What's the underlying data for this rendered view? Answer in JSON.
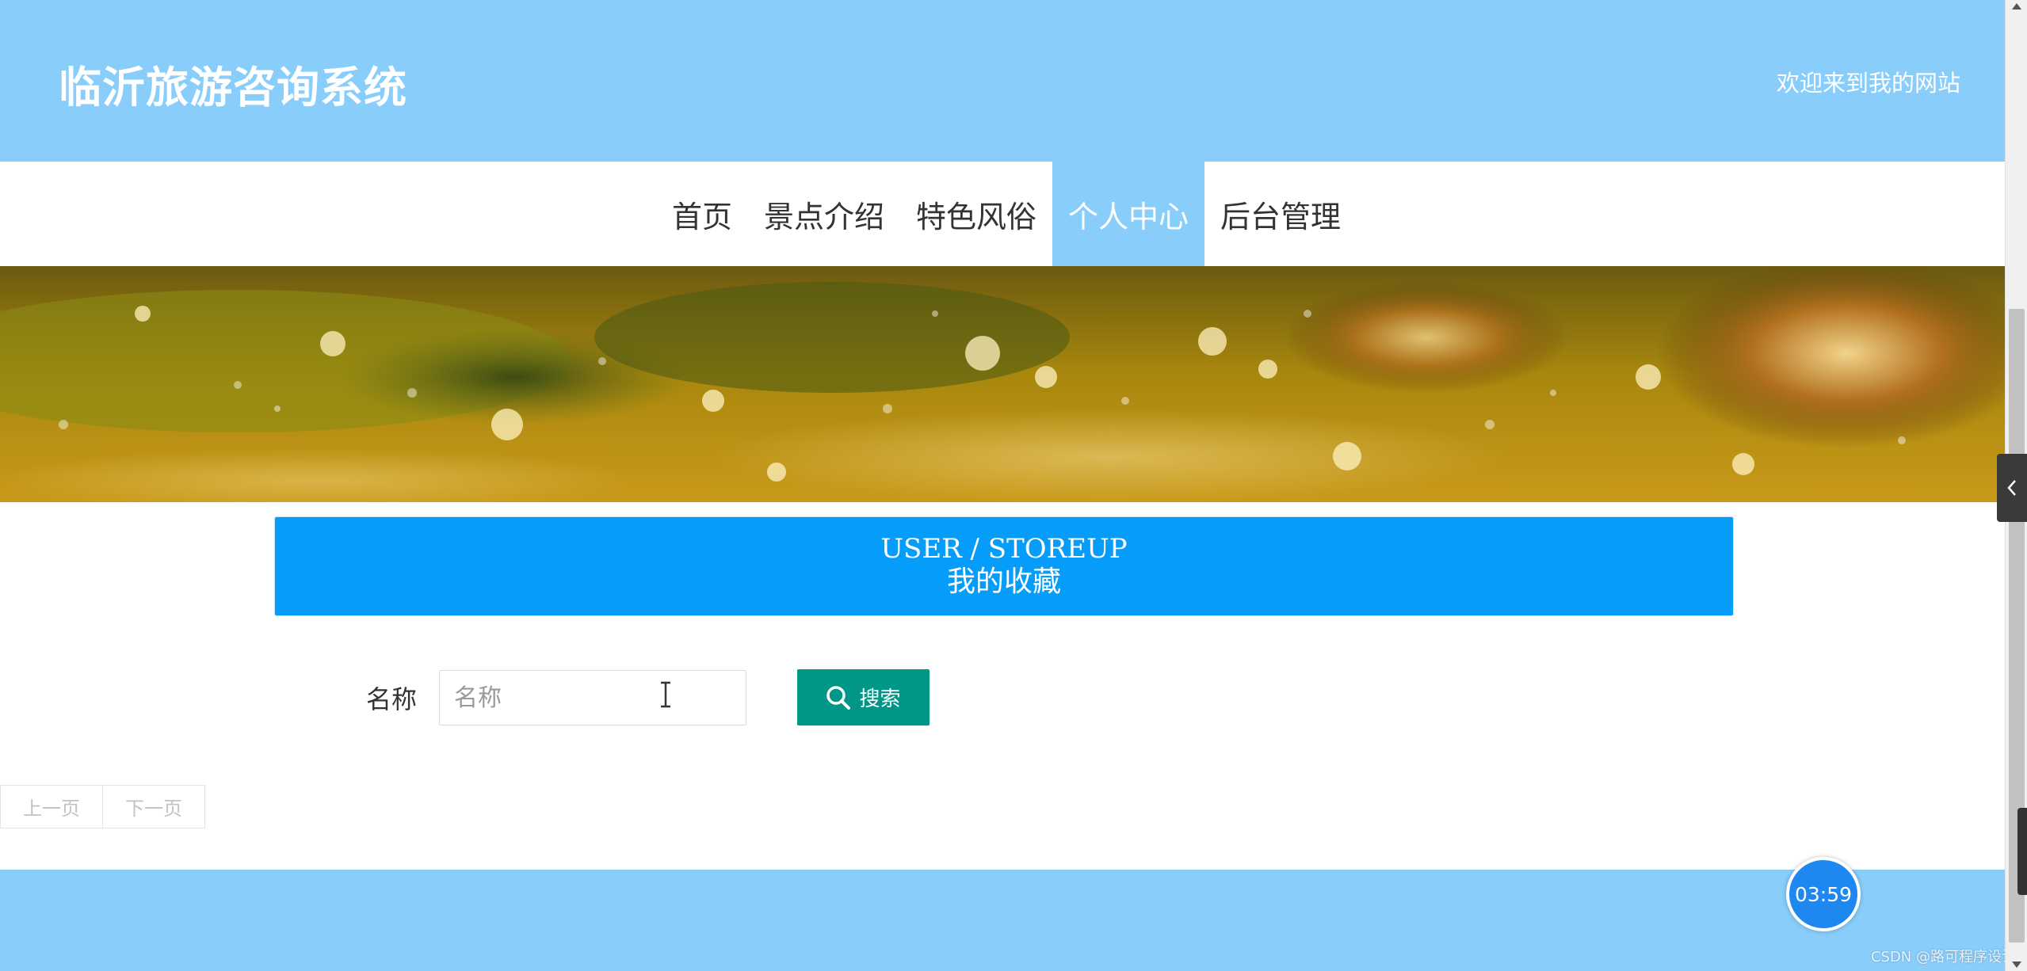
{
  "header": {
    "site_title": "临沂旅游咨询系统",
    "welcome_text": "欢迎来到我的网站"
  },
  "nav": {
    "items": [
      {
        "label": "首页"
      },
      {
        "label": "景点介绍"
      },
      {
        "label": "特色风俗"
      },
      {
        "label": "个人中心",
        "active": true
      },
      {
        "label": "后台管理"
      }
    ]
  },
  "banner": {
    "slide_count": 3,
    "active_slide": 1
  },
  "section": {
    "title_en": "USER / STOREUP",
    "title_cn": "我的收藏"
  },
  "search": {
    "label": "名称",
    "placeholder": "名称",
    "value": "",
    "button_label": "搜索",
    "button_icon": "search-icon"
  },
  "pagination": {
    "prev_label": "上一页",
    "next_label": "下一页"
  },
  "timer": {
    "text": "03:59"
  },
  "watermark": {
    "text": "CSDN @路可程序设计"
  },
  "side_tab": {
    "icon": "chevron-left-icon"
  },
  "colors": {
    "header_bg": "#89cdfb",
    "section_bg": "#069dfa",
    "search_button": "#009688",
    "timer_bg": "#1e88f0"
  }
}
